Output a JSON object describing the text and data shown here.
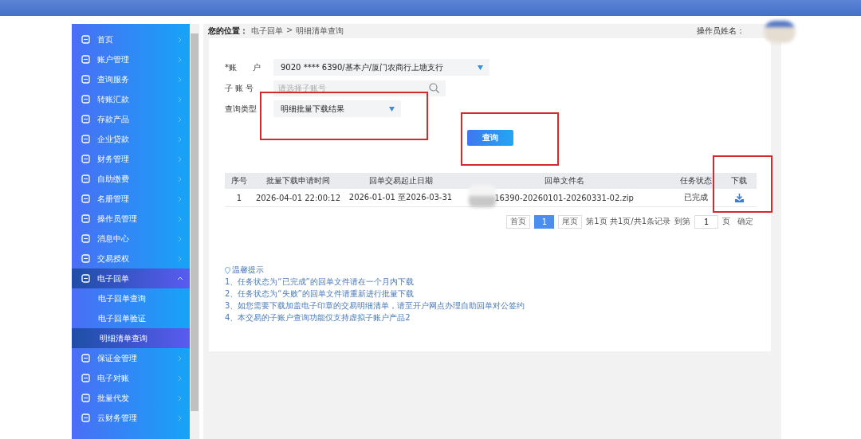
{
  "sidebar": {
    "items": [
      {
        "label": "首页",
        "expanded": false,
        "selected": false
      },
      {
        "label": "账户管理",
        "expanded": false,
        "selected": false
      },
      {
        "label": "查询服务",
        "expanded": false,
        "selected": false
      },
      {
        "label": "转账汇款",
        "expanded": false,
        "selected": false
      },
      {
        "label": "存款产品",
        "expanded": false,
        "selected": false
      },
      {
        "label": "企业贷款",
        "expanded": false,
        "selected": false
      },
      {
        "label": "财务管理",
        "expanded": false,
        "selected": false
      },
      {
        "label": "自助缴费",
        "expanded": false,
        "selected": false
      },
      {
        "label": "名册管理",
        "expanded": false,
        "selected": false
      },
      {
        "label": "操作员管理",
        "expanded": false,
        "selected": false
      },
      {
        "label": "消息中心",
        "expanded": false,
        "selected": false
      },
      {
        "label": "交易授权",
        "expanded": false,
        "selected": false
      },
      {
        "label": "电子回单",
        "expanded": true,
        "selected": false,
        "children": [
          {
            "label": "电子回单查询",
            "selected": false
          },
          {
            "label": "电子回单验证",
            "selected": false
          },
          {
            "label": "明细清单查询",
            "selected": true
          }
        ]
      },
      {
        "label": "保证金管理",
        "expanded": false,
        "selected": false
      },
      {
        "label": "电子对账",
        "expanded": false,
        "selected": false
      },
      {
        "label": "批量代发",
        "expanded": false,
        "selected": false
      },
      {
        "label": "云财务管理",
        "expanded": false,
        "selected": false
      }
    ]
  },
  "breadcrumb": {
    "label": "您的位置：",
    "path": [
      "电子回单",
      "明细清单查询"
    ],
    "separator": ">"
  },
  "operator": {
    "label": "操作员姓名："
  },
  "form": {
    "fields": [
      {
        "kind": "select",
        "label": "*账　　户",
        "value": "9020 **** 6390/基本户/厦门农商行上塘支行"
      },
      {
        "kind": "search",
        "label": "子 账 号",
        "placeholder": "请选择子账号"
      },
      {
        "kind": "select",
        "label": "查询类型",
        "value": "明细批量下载结果"
      }
    ],
    "submit": "查询"
  },
  "table": {
    "columns": [
      "序号",
      "批量下载申请时间",
      "回单交易起止日期",
      "回单文件名",
      "任务状态",
      "下载"
    ],
    "rows": [
      [
        "1",
        "2026-04-01 22:00:12",
        "2026-01-01 至2026-03-31",
        "16390-20260101-20260331-02.zip",
        "已完成"
      ]
    ]
  },
  "pagination": {
    "first": "首页",
    "pages": [
      {
        "label": "1",
        "selected": true
      }
    ],
    "last": "尾页",
    "summary": "第1页 共1页/共1条记录",
    "goto_label": "到第",
    "goto_value": "1",
    "unit": "页",
    "confirm": "确定"
  },
  "tips": {
    "title": "温馨提示",
    "items": [
      "1、任务状态为“已完成”的回单文件请在一个月内下载",
      "2、任务状态为“失败”的回单文件请重新进行批量下载",
      "3、如您需要下载加盖电子印章的交易明细清单，请至开户网点办理自助回单对公签约",
      "4、本交易的子账户查询功能仅支持虚拟子账户产品2"
    ]
  }
}
